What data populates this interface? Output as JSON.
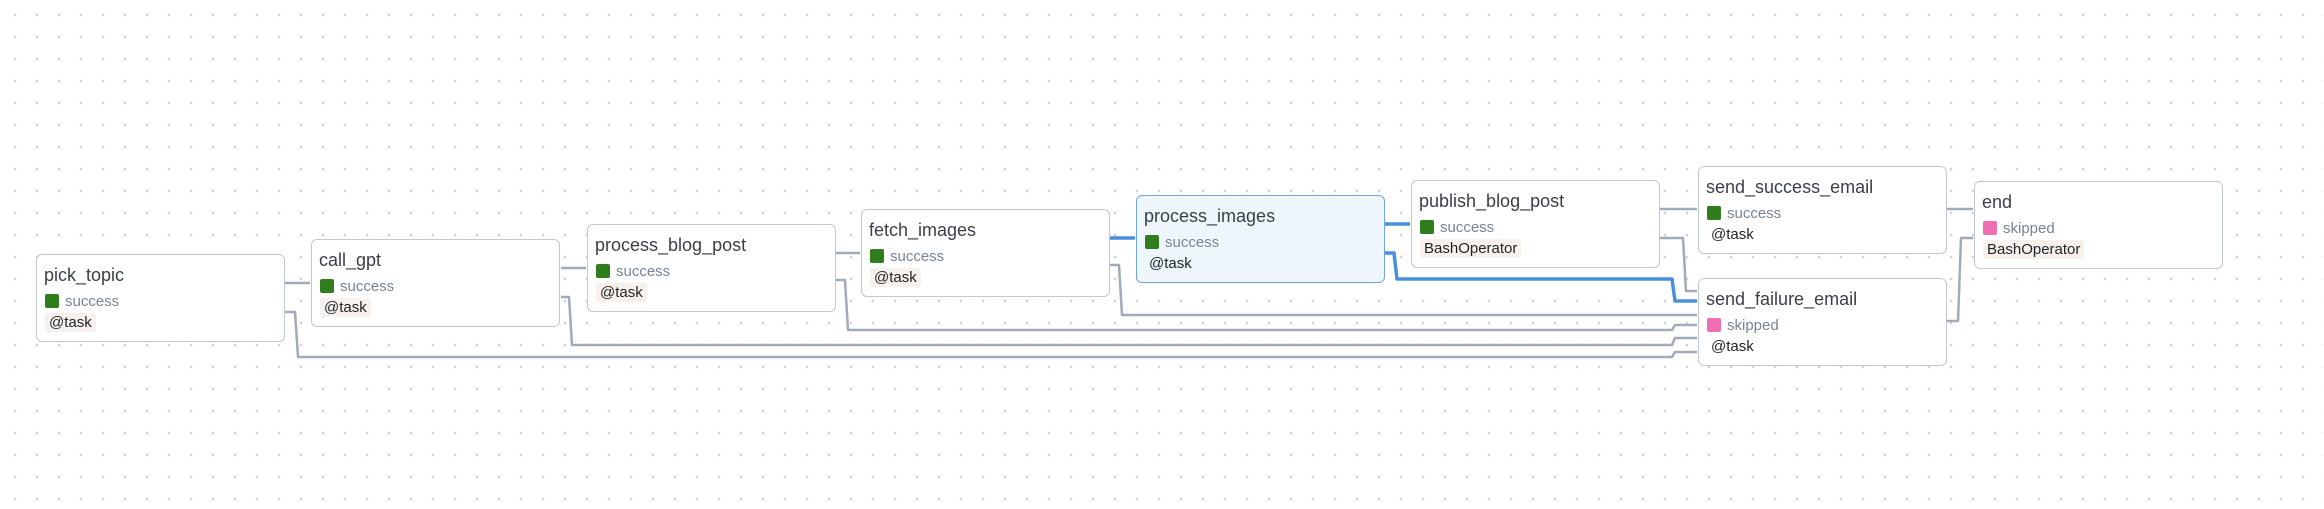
{
  "colors": {
    "success": "#2f7d1c",
    "skipped": "#ee6fb3",
    "edge": "#a3abb8",
    "edge_active": "#4a8fdc",
    "selected_bg": "#eef6fc"
  },
  "nodes": [
    {
      "id": "pick_topic",
      "title": "pick_topic",
      "status": "success",
      "operator": "@task"
    },
    {
      "id": "call_gpt",
      "title": "call_gpt",
      "status": "success",
      "operator": "@task"
    },
    {
      "id": "process_blog_post",
      "title": "process_blog_post",
      "status": "success",
      "operator": "@task"
    },
    {
      "id": "fetch_images",
      "title": "fetch_images",
      "status": "success",
      "operator": "@task"
    },
    {
      "id": "process_images",
      "title": "process_images",
      "status": "success",
      "operator": "@task"
    },
    {
      "id": "publish_blog_post",
      "title": "publish_blog_post",
      "status": "success",
      "operator": "BashOperator"
    },
    {
      "id": "send_success_email",
      "title": "send_success_email",
      "status": "success",
      "operator": "@task"
    },
    {
      "id": "send_failure_email",
      "title": "send_failure_email",
      "status": "skipped",
      "operator": "@task"
    },
    {
      "id": "end",
      "title": "end",
      "status": "skipped",
      "operator": "BashOperator"
    }
  ],
  "edges": [
    {
      "from": "pick_topic",
      "to": "call_gpt"
    },
    {
      "from": "call_gpt",
      "to": "process_blog_post"
    },
    {
      "from": "process_blog_post",
      "to": "fetch_images"
    },
    {
      "from": "fetch_images",
      "to": "process_images"
    },
    {
      "from": "process_images",
      "to": "publish_blog_post",
      "active": true
    },
    {
      "from": "publish_blog_post",
      "to": "send_success_email"
    },
    {
      "from": "publish_blog_post",
      "to": "send_failure_email"
    },
    {
      "from": "send_success_email",
      "to": "end"
    },
    {
      "from": "send_failure_email",
      "to": "end"
    },
    {
      "from": "process_images",
      "to": "send_failure_email",
      "active": true
    },
    {
      "from": "fetch_images",
      "to": "send_failure_email"
    },
    {
      "from": "process_blog_post",
      "to": "send_failure_email"
    },
    {
      "from": "call_gpt",
      "to": "send_failure_email"
    },
    {
      "from": "pick_topic",
      "to": "send_failure_email"
    }
  ]
}
